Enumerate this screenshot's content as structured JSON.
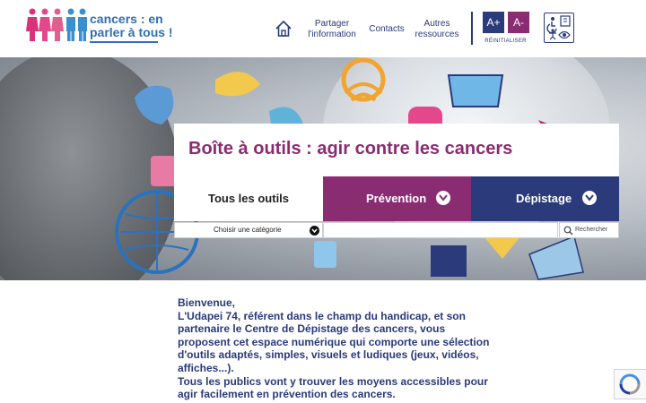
{
  "header": {
    "logo_text_line1": "cancers : en",
    "logo_text_line2": "parler à tous !",
    "nav": [
      {
        "label": "Partager l'information"
      },
      {
        "label": "Contacts"
      },
      {
        "label": "Autres ressources"
      }
    ],
    "font_increase": "A+",
    "font_decrease": "A-",
    "reset_label": "RÉINITIALISER"
  },
  "hero": {
    "title": "Boîte à outils : agir contre les cancers",
    "tabs": [
      {
        "label": "Tous les outils"
      },
      {
        "label": "Prévention"
      },
      {
        "label": "Dépistage"
      }
    ],
    "category_select": "Choisir une catégorie",
    "search_button": "Rechercher"
  },
  "intro": {
    "lines": [
      "Bienvenue,",
      "L'Udapei 74, référent dans le champ du handicap, et son partenaire le Centre de Dépistage des cancers, vous proposent cet espace numérique qui comporte une sélection d'outils adaptés, simples, visuels et ludiques (jeux, vidéos, affiches...).",
      "Tous les publics vont y trouver les moyens accessibles pour agir facilement en prévention des cancers."
    ]
  },
  "colors": {
    "navy": "#2a3a7a",
    "plum": "#8a2c72",
    "logo_blue": "#2f6fb3"
  }
}
